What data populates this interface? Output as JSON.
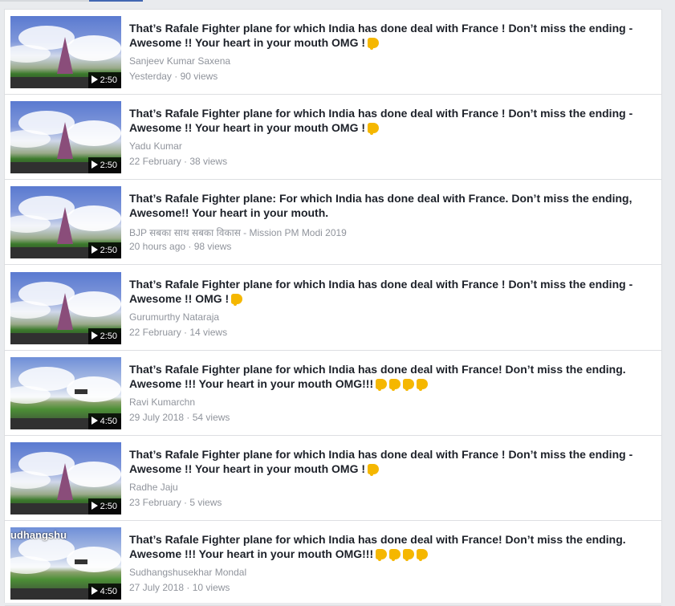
{
  "items": [
    {
      "title": "That’s Rafale Fighter plane for which India has done deal with France ! Don’t miss the ending - Awesome !! Your heart in your mouth OMG !",
      "emoji_count": 1,
      "author": "Sanjeev Kumar Saxena",
      "date": "Yesterday",
      "views": "90 views",
      "duration": "2:50",
      "thumb_style": "standard",
      "overlay": ""
    },
    {
      "title": "That’s Rafale Fighter plane for which India has done deal with France ! Don’t miss the ending - Awesome !! Your heart in your mouth OMG !",
      "emoji_count": 1,
      "author": "Yadu Kumar",
      "date": "22 February",
      "views": "38 views",
      "duration": "2:50",
      "thumb_style": "standard",
      "overlay": ""
    },
    {
      "title": "That’s Rafale Fighter plane: For which India has done deal with France. Don’t miss the ending, Awesome!! Your heart in your mouth.",
      "emoji_count": 0,
      "author": "BJP सबका साथ सबका विकास - Mission PM Modi 2019",
      "date": "20 hours ago",
      "views": "98 views",
      "duration": "2:50",
      "thumb_style": "standard",
      "overlay": ""
    },
    {
      "title": "That’s Rafale Fighter plane for which India has done deal with France ! Don’t miss the ending - Awesome !! OMG !",
      "emoji_count": 1,
      "author": "Gurumurthy Nataraja",
      "date": "22 February",
      "views": "14 views",
      "duration": "2:50",
      "thumb_style": "standard",
      "overlay": ""
    },
    {
      "title": "That’s Rafale Fighter plane for which India has done deal with France! Don’t miss the ending. Awesome !!! Your heart in your mouth OMG!!!",
      "emoji_count": 4,
      "author": "Ravi Kumarchn",
      "date": "29 July 2018",
      "views": "54 views",
      "duration": "4:50",
      "thumb_style": "alt",
      "overlay": ""
    },
    {
      "title": "That’s Rafale Fighter plane for which India has done deal with France ! Don’t miss the ending - Awesome !! Your heart in your mouth OMG !",
      "emoji_count": 1,
      "author": "Radhe Jaju",
      "date": "23 February",
      "views": "5 views",
      "duration": "2:50",
      "thumb_style": "standard",
      "overlay": ""
    },
    {
      "title": "That’s Rafale Fighter plane for which India has done deal with France! Don’t miss the ending. Awesome !!! Your heart in your mouth OMG!!!",
      "emoji_count": 4,
      "author": "Sudhangshusekhar Mondal",
      "date": "27 July 2018",
      "views": "10 views",
      "duration": "4:50",
      "thumb_style": "alt",
      "overlay": "udhangshu"
    }
  ],
  "meta_separator": " · ",
  "emoji_icon": "backhand-index-pointing-down-icon"
}
